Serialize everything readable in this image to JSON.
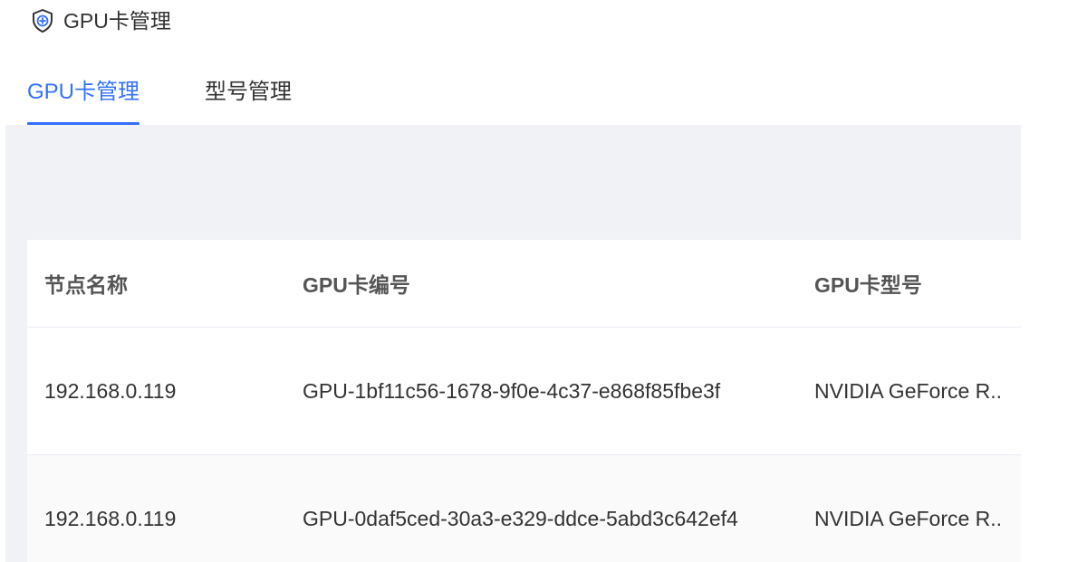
{
  "header": {
    "title": "GPU卡管理",
    "icon": "shield-plus-icon"
  },
  "tabs": [
    {
      "label": "GPU卡管理",
      "active": true
    },
    {
      "label": "型号管理",
      "active": false
    }
  ],
  "colors": {
    "accent": "#3370ff",
    "content_bg": "#f0f2f5"
  },
  "table": {
    "columns": [
      "节点名称",
      "GPU卡编号",
      "GPU卡型号"
    ],
    "rows": [
      {
        "node": "192.168.0.119",
        "gpu_id": "GPU-1bf11c56-1678-9f0e-4c37-e868f85fbe3f",
        "model": "NVIDIA GeForce R.."
      },
      {
        "node": "192.168.0.119",
        "gpu_id": "GPU-0daf5ced-30a3-e329-ddce-5abd3c642ef4",
        "model": "NVIDIA GeForce R.."
      }
    ]
  }
}
